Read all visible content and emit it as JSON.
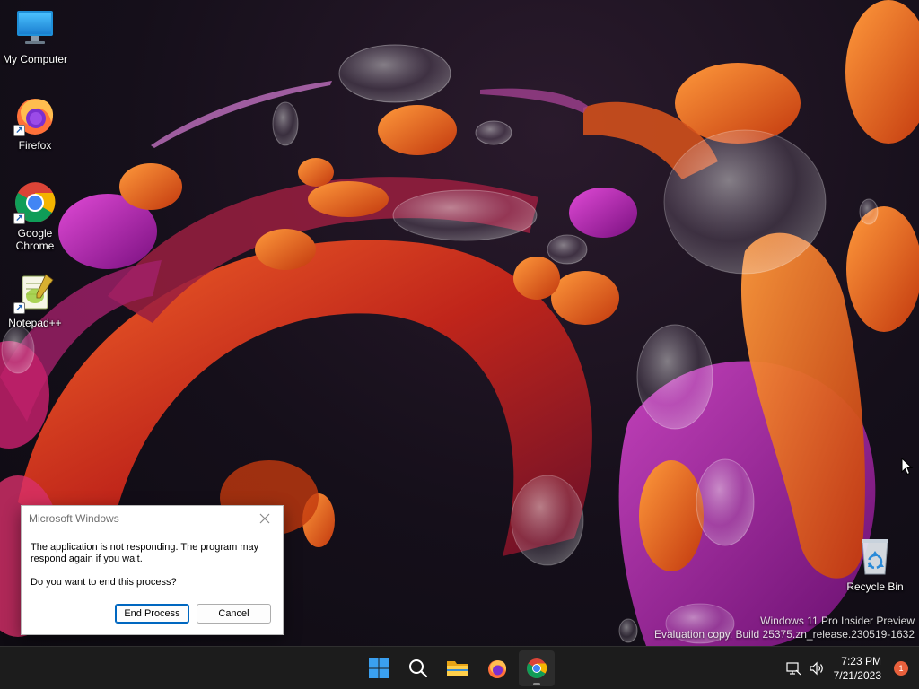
{
  "desktop": {
    "icons": [
      {
        "label": "My Computer",
        "icon": "monitor-icon"
      },
      {
        "label": "Firefox",
        "icon": "firefox-icon"
      },
      {
        "label": "Google Chrome",
        "icon": "chrome-icon"
      },
      {
        "label": "Notepad++",
        "icon": "notepadpp-icon"
      },
      {
        "label": "Recycle Bin",
        "icon": "recycle-bin-icon"
      }
    ],
    "watermark": {
      "line1": "Windows 11 Pro Insider Preview",
      "line2": "Evaluation copy. Build 25375.zn_release.230519-1632"
    }
  },
  "dialog": {
    "title": "Microsoft Windows",
    "message": "The application is not responding. The program may respond again if you wait.",
    "question": "Do you want to end this process?",
    "end_label": "End Process",
    "cancel_label": "Cancel"
  },
  "taskbar": {
    "apps": [
      "start-icon",
      "search-icon",
      "file-explorer-icon",
      "firefox-icon",
      "chrome-icon"
    ],
    "time": "7:23 PM",
    "date": "7/21/2023",
    "notification_count": "1"
  },
  "colors": {
    "accent": "#0067c0",
    "taskbar": "#1c1c1c",
    "badge": "#e8603c"
  }
}
